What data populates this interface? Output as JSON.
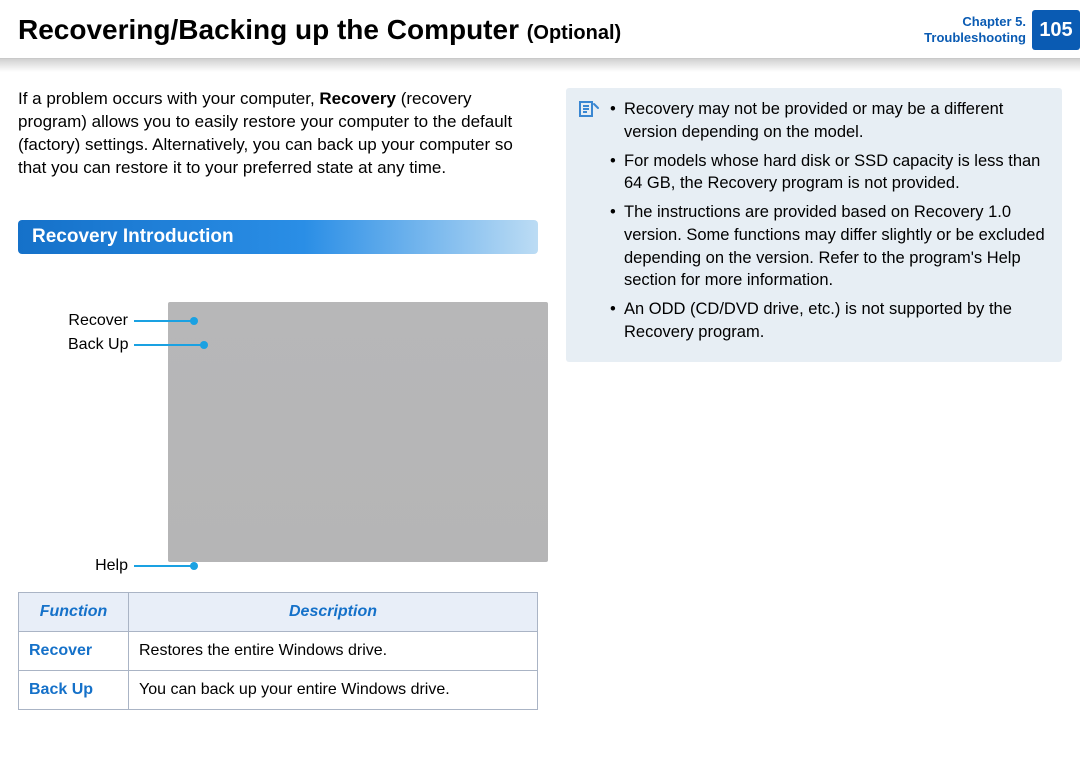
{
  "header": {
    "title": "Recovering/Backing up the Computer",
    "suffix": "(Optional)",
    "chapter_line1": "Chapter 5.",
    "chapter_line2": "Troubleshooting",
    "page": "105"
  },
  "intro": {
    "p1a": "If a problem occurs with your computer, ",
    "p1b": "Recovery",
    "p1c": " (recovery program) allows you to easily restore your computer to the default (factory) settings. Alternatively, you can back up your computer so that you can restore it to your preferred state at any time."
  },
  "section_title": "Recovery Introduction",
  "callouts": {
    "recover": "Recover",
    "backup": "Back Up",
    "help": "Help"
  },
  "table": {
    "head_function": "Function",
    "head_description": "Description",
    "rows": [
      {
        "fn": "Recover",
        "desc": "Restores the entire Windows drive."
      },
      {
        "fn": "Back Up",
        "desc": "You can back up your entire Windows drive."
      }
    ]
  },
  "notes": [
    "Recovery may not be provided or may be a different version depending on the model.",
    "For models whose hard disk or SSD capacity is less than 64 GB, the Recovery program is not provided.",
    "The instructions are provided based on Recovery 1.0 version. Some functions may differ slightly or be excluded depending on the version. Refer to the program's Help section for more information.",
    "An ODD (CD/DVD drive, etc.) is not supported by the Recovery program."
  ]
}
